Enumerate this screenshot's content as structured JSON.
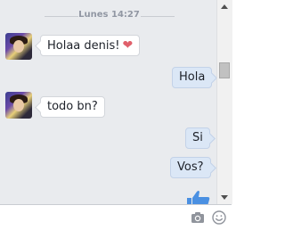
{
  "chat": {
    "timestamp": "Lunes 14:27",
    "messages": [
      {
        "direction": "in",
        "text": "Holaa denis!",
        "emoji": "heart"
      },
      {
        "direction": "out",
        "text": "Hola"
      },
      {
        "direction": "in",
        "text": "todo bn?"
      },
      {
        "direction": "out",
        "text": "Si"
      },
      {
        "direction": "out",
        "text": "Vos?"
      }
    ],
    "like": "thumbs-up-icon"
  },
  "composer": {
    "value": "",
    "placeholder": "",
    "icons": [
      "camera-icon",
      "emoji-icon"
    ]
  },
  "colors": {
    "accent": "#4a90e2",
    "background": "#e9ebee",
    "outgoing_bubble": "#dbe7f6",
    "heart": "#e0606b"
  }
}
